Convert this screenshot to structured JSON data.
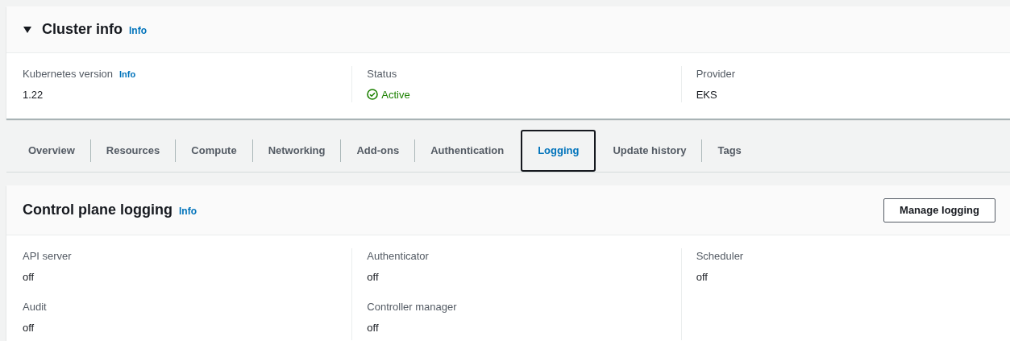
{
  "cluster_info": {
    "title": "Cluster info",
    "info_link": "Info",
    "expanded": true,
    "fields": [
      {
        "label": "Kubernetes version",
        "info_link": "Info",
        "value": "1.22",
        "kind": "text"
      },
      {
        "label": "Status",
        "value": "Active",
        "kind": "status"
      },
      {
        "label": "Provider",
        "value": "EKS",
        "kind": "text"
      }
    ]
  },
  "tabs": [
    {
      "label": "Overview",
      "selected": false
    },
    {
      "label": "Resources",
      "selected": false
    },
    {
      "label": "Compute",
      "selected": false
    },
    {
      "label": "Networking",
      "selected": false
    },
    {
      "label": "Add-ons",
      "selected": false
    },
    {
      "label": "Authentication",
      "selected": false
    },
    {
      "label": "Logging",
      "selected": true
    },
    {
      "label": "Update history",
      "selected": false
    },
    {
      "label": "Tags",
      "selected": false
    }
  ],
  "control_plane_logging": {
    "title": "Control plane logging",
    "info_link": "Info",
    "button": "Manage logging",
    "columns": [
      [
        {
          "label": "API server",
          "value": "off"
        },
        {
          "label": "Audit",
          "value": "off"
        }
      ],
      [
        {
          "label": "Authenticator",
          "value": "off"
        },
        {
          "label": "Controller manager",
          "value": "off"
        }
      ],
      [
        {
          "label": "Scheduler",
          "value": "off"
        }
      ]
    ]
  }
}
